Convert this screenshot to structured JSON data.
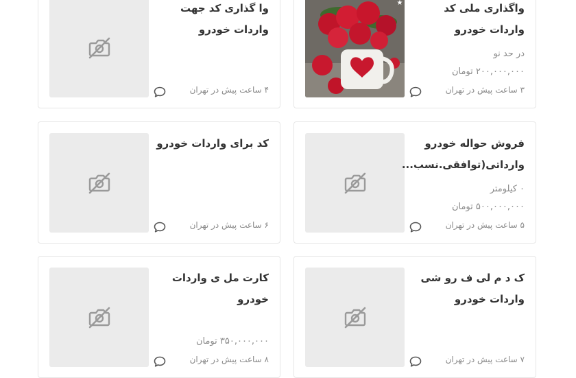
{
  "listings": [
    {
      "title": "واگذاری ملی کد واردات خودرو",
      "detail": "در حد نو",
      "price": "۲۰۰,۰۰۰,۰۰۰ تومان",
      "meta": "۳ ساعت پیش در تهران",
      "has_photo": true,
      "photo_icon": "roses-in-heart-mug-photo"
    },
    {
      "title": "وا گذاری کد جهت واردات خودرو",
      "meta": "۴ ساعت پیش در تهران",
      "has_photo": false,
      "photo_icon": "no-image-icon"
    },
    {
      "title": "فروش حواله خودرو وارداتی(توافقی.نسب...",
      "detail": "۰ کیلومتر",
      "price": "۵۰۰,۰۰۰,۰۰۰ تومان",
      "meta": "۵ ساعت پیش در تهران",
      "has_photo": false,
      "photo_icon": "no-image-icon"
    },
    {
      "title": "کد برای واردات خودرو",
      "meta": "۶ ساعت پیش در تهران",
      "has_photo": false,
      "photo_icon": "no-image-icon"
    },
    {
      "title": "ک د م لی ف رو شی واردات خودرو",
      "meta": "۷ ساعت پیش در تهران",
      "has_photo": false,
      "photo_icon": "no-image-icon"
    },
    {
      "title": "کارت مل ی واردات خودرو",
      "price": "۳۵۰,۰۰۰,۰۰۰ تومان",
      "meta": "۸ ساعت پیش در تهران",
      "has_photo": false,
      "photo_icon": "no-image-icon"
    }
  ],
  "chat_icon": "chat-bubble-icon"
}
